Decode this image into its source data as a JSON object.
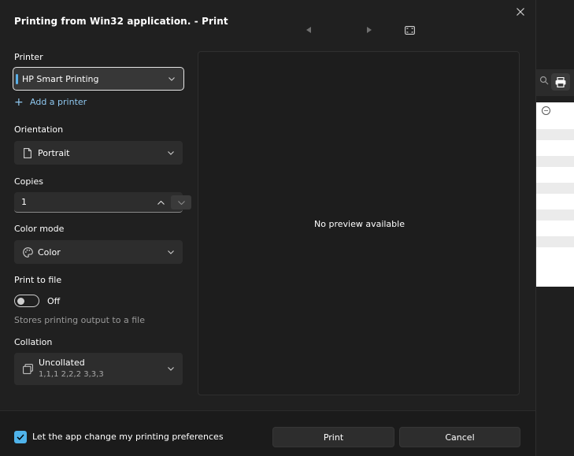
{
  "dialog": {
    "title": "Printing from Win32 application. - Print",
    "close_icon": "close-icon"
  },
  "printer": {
    "label": "Printer",
    "value": "HP Smart Printing",
    "add_printer": "Add a printer"
  },
  "orientation": {
    "label": "Orientation",
    "value": "Portrait",
    "icon": "page-icon"
  },
  "copies": {
    "label": "Copies",
    "value": "1"
  },
  "color_mode": {
    "label": "Color mode",
    "value": "Color",
    "icon": "palette-icon"
  },
  "print_to_file": {
    "label": "Print to file",
    "state": "Off",
    "hint": "Stores printing output to a file"
  },
  "collation": {
    "label": "Collation",
    "value": "Uncollated",
    "detail": "1,1,1  2,2,2  3,3,3",
    "icon": "pages-stack-icon"
  },
  "preview": {
    "message": "No preview available"
  },
  "footer": {
    "checkbox_label": "Let the app change my printing preferences",
    "checked": true,
    "print_label": "Print",
    "cancel_label": "Cancel"
  },
  "colors": {
    "accent": "#4fb3ea",
    "dialog_bg": "#202020",
    "control_bg": "#2d2d2d"
  }
}
